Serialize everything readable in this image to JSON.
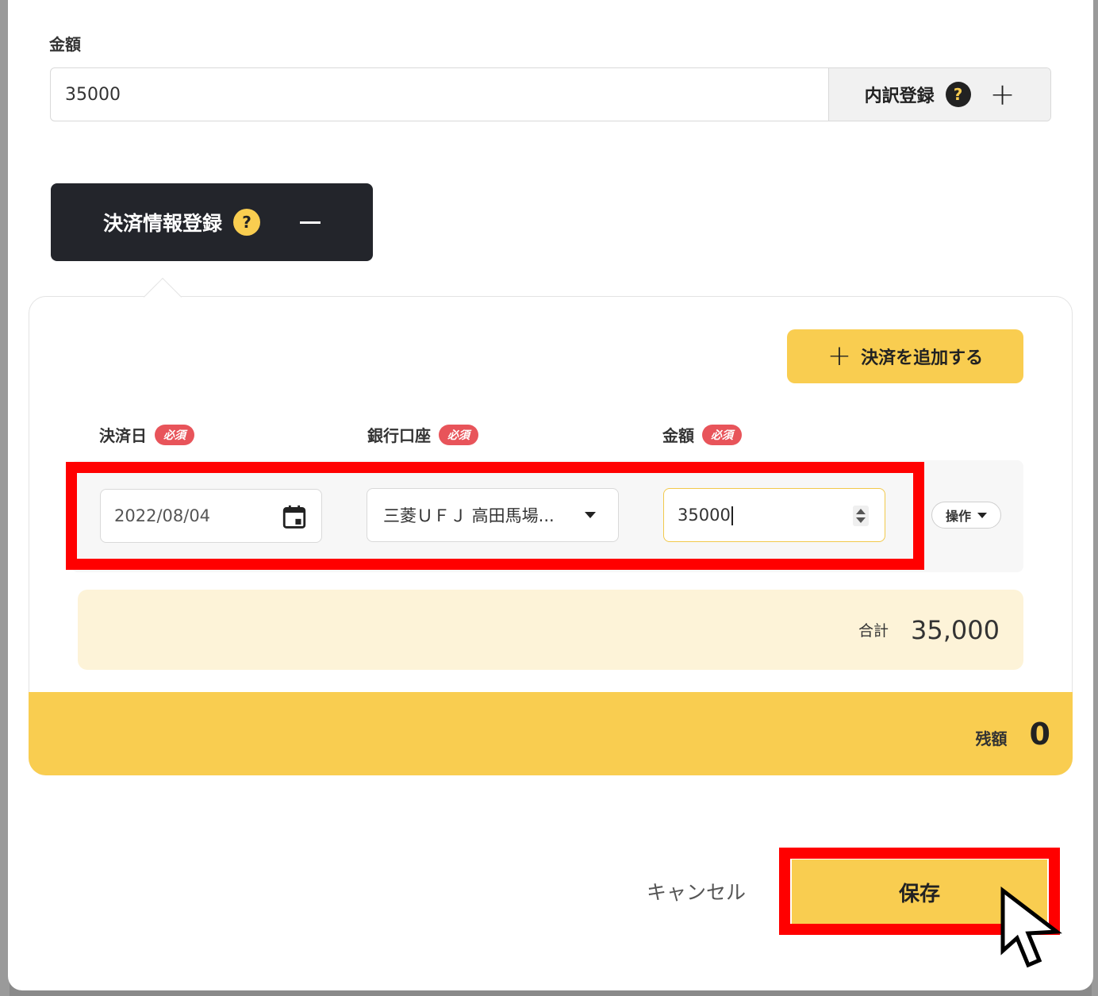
{
  "form": {
    "amount_label": "金額",
    "amount_value": "35000",
    "breakdown_label": "内訳登録",
    "help_mark": "?"
  },
  "payment": {
    "section_label": "決済情報登録",
    "help_mark": "?",
    "add_button_label": "決済を追加する",
    "columns": {
      "date_label": "決済日",
      "bank_label": "銀行口座",
      "amount_label": "金額",
      "required_badge": "必須"
    },
    "row": {
      "date_value": "2022/08/04",
      "bank_value": "三菱ＵＦＪ 高田馬場...",
      "amount_value": "35000",
      "ops_label": "操作"
    },
    "total_label": "合計",
    "total_value": "35,000",
    "remaining_label": "残額",
    "remaining_value": "0"
  },
  "footer": {
    "cancel_label": "キャンセル",
    "save_label": "保存"
  },
  "colors": {
    "accent_yellow": "#f9cd50",
    "dark_tab": "#23252b",
    "required_red": "#e8545a",
    "annotation_red": "#ff0000",
    "total_bg": "#fdf3d8"
  }
}
